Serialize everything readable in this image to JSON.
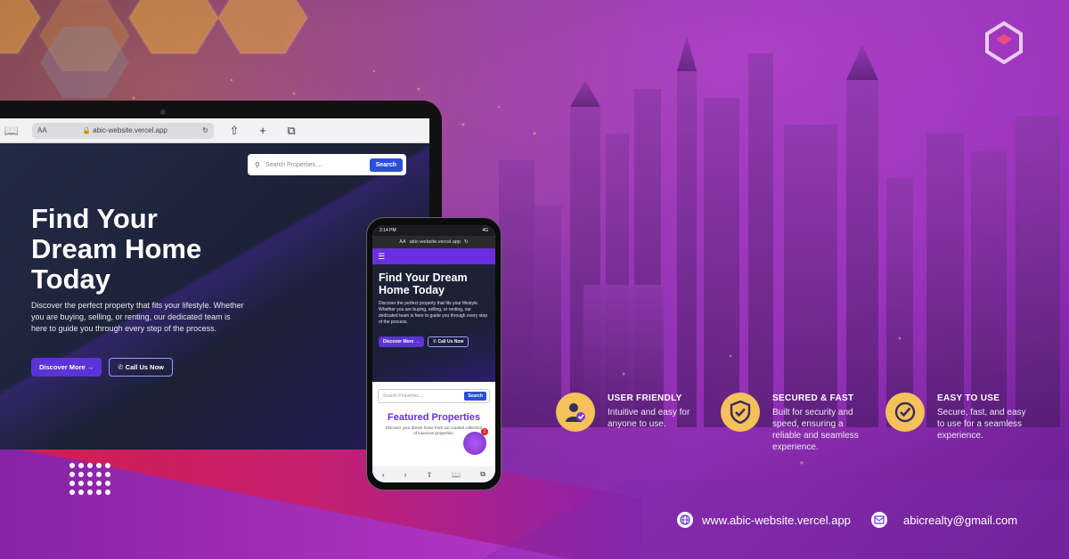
{
  "colors": {
    "accent_yellow": "#f4c15a",
    "brand_purple": "#6a2ee0",
    "button_blue": "#2a4fd8",
    "band_red": "#e0204a"
  },
  "laptop": {
    "browser": {
      "text_size": "AA",
      "url": "abic-website.vercel.app"
    },
    "site": {
      "search_placeholder": "Search Properties....",
      "search_button": "Search",
      "hero_title": "Find Your Dream Home Today",
      "hero_desc": "Discover the perfect property that fits your lifestyle. Whether you are buying, selling, or renting, our dedicated team is here to guide you through every step of the process.",
      "discover_button": "Discover More",
      "call_button": "Call Us Now"
    }
  },
  "phone": {
    "time": "2:14 PM",
    "signal": "4G",
    "text_size": "AA",
    "url": "abic-website.vercel.app",
    "hero_title": "Find Your Dream Home Today",
    "hero_desc": "Discover the perfect property that fits your lifestyle. Whether you are buying, selling, or renting, our dedicated team is here to guide you through every step of the process.",
    "discover_button": "Discover More",
    "call_button": "Call Us Now",
    "search_placeholder": "Search Properties....",
    "search_button": "Search",
    "featured_title": "Featured Properties",
    "featured_desc": "Discover your dream home from our curated collection of luxurious properties.",
    "badge": "1"
  },
  "features": [
    {
      "title": "USER FRIENDLY",
      "desc": "Intuitive and easy for anyone to use.",
      "icon": "user-check-icon"
    },
    {
      "title": "SECURED & FAST",
      "desc": "Built for security and speed, ensuring a reliable and seamless experience.",
      "icon": "shield-check-icon"
    },
    {
      "title": "EASY TO USE",
      "desc": "Secure, fast, and easy to use for a seamless experience.",
      "icon": "check-circle-icon"
    }
  ],
  "contact": {
    "website": "www.abic-website.vercel.app",
    "email": "abicrealty@gmail.com"
  }
}
